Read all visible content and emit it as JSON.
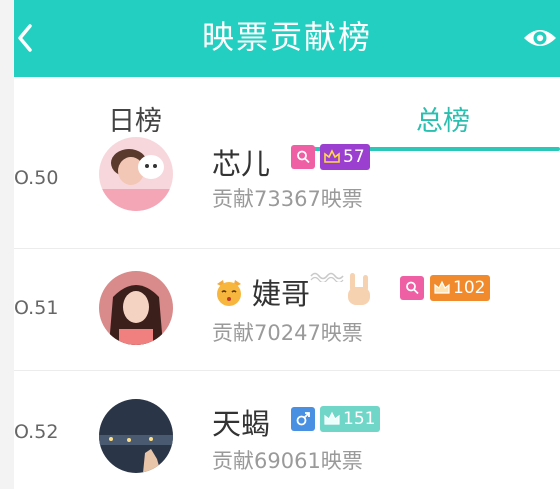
{
  "header": {
    "title": "映票贡献榜",
    "back_icon": "chevron-left-icon",
    "eye_icon": "eye-icon",
    "bg_color": "#22cfc0"
  },
  "tabs": [
    {
      "label": "日榜",
      "active": false
    },
    {
      "label": "总榜",
      "active": true
    }
  ],
  "rows": [
    {
      "rank": "O.50",
      "name": "芯儿",
      "gender": "female",
      "level": "57",
      "level_color": "#9b3fd0",
      "contribution": "贡献73367映票"
    },
    {
      "rank": "O.51",
      "name": "婕哥",
      "gender": "female",
      "level": "102",
      "level_color": "#f08a2c",
      "contribution": "贡献70247映票"
    },
    {
      "rank": "O.52",
      "name": "天蝎",
      "gender": "male",
      "level": "151",
      "level_color": "#6fd6c8",
      "contribution": "贡献69061映票"
    }
  ],
  "colors": {
    "accent": "#2bc7b8",
    "female_badge": "#ef5fa4",
    "male_badge": "#4a90e2"
  }
}
